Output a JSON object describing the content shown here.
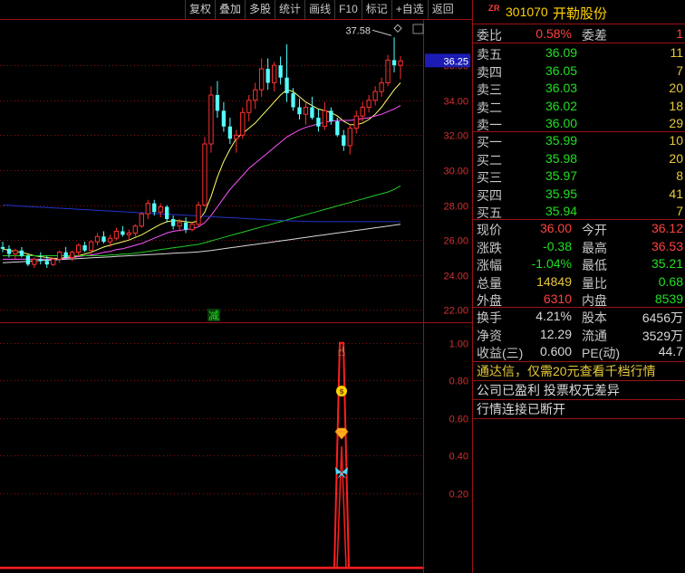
{
  "toolbar": [
    "复权",
    "叠加",
    "多股",
    "统计",
    "画线",
    "F10",
    "标记",
    "+自选",
    "返回"
  ],
  "stock": {
    "badge": "ZR",
    "code": "301070",
    "name": "开勒股份"
  },
  "weibi": {
    "label": "委比",
    "value": "0.58%",
    "label2": "委差",
    "value2": "1"
  },
  "sell": [
    {
      "label": "卖五",
      "price": "36.09",
      "vol": "11"
    },
    {
      "label": "卖四",
      "price": "36.05",
      "vol": "7"
    },
    {
      "label": "卖三",
      "price": "36.03",
      "vol": "20"
    },
    {
      "label": "卖二",
      "price": "36.02",
      "vol": "18"
    },
    {
      "label": "卖一",
      "price": "36.00",
      "vol": "29"
    }
  ],
  "buy": [
    {
      "label": "买一",
      "price": "35.99",
      "vol": "10"
    },
    {
      "label": "买二",
      "price": "35.98",
      "vol": "20"
    },
    {
      "label": "买三",
      "price": "35.97",
      "vol": "8"
    },
    {
      "label": "买四",
      "price": "35.95",
      "vol": "41"
    },
    {
      "label": "买五",
      "price": "35.94",
      "vol": "7"
    }
  ],
  "quote": [
    {
      "l1": "现价",
      "v1": "36.00",
      "c1": "red",
      "l2": "今开",
      "v2": "36.12",
      "c2": "red"
    },
    {
      "l1": "涨跌",
      "v1": "-0.38",
      "c1": "green",
      "l2": "最高",
      "v2": "36.53",
      "c2": "red"
    },
    {
      "l1": "涨幅",
      "v1": "-1.04%",
      "c1": "green",
      "l2": "最低",
      "v2": "35.21",
      "c2": "green"
    },
    {
      "l1": "总量",
      "v1": "14849",
      "c1": "yellow",
      "l2": "量比",
      "v2": "0.68",
      "c2": "green"
    },
    {
      "l1": "外盘",
      "v1": "6310",
      "c1": "red",
      "l2": "内盘",
      "v2": "8539",
      "c2": "green"
    }
  ],
  "fund": [
    {
      "l1": "换手",
      "v1": "4.21%",
      "l2": "股本",
      "v2": "6456万"
    },
    {
      "l1": "净资",
      "v1": "12.29",
      "l2": "流通",
      "v2": "3529万"
    },
    {
      "l1": "收益(三)",
      "v1": "0.600",
      "l2": "PE(动)",
      "v2": "44.7"
    }
  ],
  "notices": [
    {
      "text": "通达信，仅需20元查看千档行情",
      "color": "yellow"
    },
    {
      "text": "公司已盈利 投票权无差异",
      "color": "white"
    },
    {
      "text": "行情连接已断开",
      "color": "white"
    }
  ],
  "chart_data": [
    {
      "type": "candlestick",
      "y_ticks": [
        "36.00",
        "34.00",
        "32.00",
        "30.00",
        "28.00",
        "26.00",
        "24.00",
        "22.00"
      ],
      "ylim": [
        21.5,
        38.6
      ],
      "high_label": "37.58",
      "current_price_label": "36.25",
      "marker_text": "减",
      "ohlc": [
        [
          25.6,
          25.9,
          25.3,
          25.5
        ],
        [
          25.5,
          25.7,
          25.0,
          25.2
        ],
        [
          25.2,
          25.5,
          24.9,
          25.4
        ],
        [
          25.4,
          25.6,
          25.0,
          25.1
        ],
        [
          25.1,
          25.2,
          24.5,
          24.6
        ],
        [
          24.6,
          25.0,
          24.4,
          24.9
        ],
        [
          24.9,
          25.3,
          24.6,
          24.8
        ],
        [
          24.8,
          25.1,
          24.4,
          24.6
        ],
        [
          24.6,
          25.0,
          24.5,
          24.9
        ],
        [
          24.9,
          25.4,
          24.7,
          25.3
        ],
        [
          25.3,
          25.6,
          24.9,
          25.0
        ],
        [
          25.0,
          25.4,
          24.8,
          25.3
        ],
        [
          25.3,
          25.8,
          25.1,
          25.7
        ],
        [
          25.7,
          25.9,
          25.3,
          25.4
        ],
        [
          25.4,
          26.0,
          25.2,
          25.9
        ],
        [
          25.9,
          26.4,
          25.7,
          26.2
        ],
        [
          26.2,
          26.5,
          25.8,
          25.9
        ],
        [
          25.9,
          26.3,
          25.6,
          26.1
        ],
        [
          26.1,
          26.7,
          26.0,
          26.5
        ],
        [
          26.5,
          26.8,
          26.2,
          26.3
        ],
        [
          26.3,
          26.6,
          26.0,
          26.4
        ],
        [
          26.4,
          26.9,
          26.2,
          26.8
        ],
        [
          26.8,
          27.6,
          26.7,
          27.5
        ],
        [
          27.5,
          28.3,
          27.2,
          28.1
        ],
        [
          28.1,
          28.3,
          27.4,
          27.6
        ],
        [
          27.6,
          28.1,
          27.3,
          27.9
        ],
        [
          27.9,
          28.0,
          27.0,
          27.2
        ],
        [
          27.2,
          27.4,
          26.6,
          26.8
        ],
        [
          26.8,
          27.2,
          26.5,
          27.0
        ],
        [
          27.0,
          27.3,
          26.4,
          26.6
        ],
        [
          26.6,
          27.0,
          26.5,
          26.9
        ],
        [
          26.9,
          28.2,
          26.8,
          28.0
        ],
        [
          28.0,
          31.9,
          27.9,
          31.5
        ],
        [
          31.5,
          34.8,
          31.0,
          34.3
        ],
        [
          34.3,
          35.1,
          33.0,
          33.4
        ],
        [
          33.4,
          33.9,
          32.2,
          32.5
        ],
        [
          32.5,
          33.0,
          31.5,
          31.8
        ],
        [
          31.8,
          32.3,
          31.0,
          32.0
        ],
        [
          32.0,
          33.6,
          31.8,
          33.3
        ],
        [
          33.3,
          34.3,
          32.8,
          34.0
        ],
        [
          34.0,
          35.0,
          33.5,
          34.6
        ],
        [
          34.6,
          36.4,
          34.2,
          35.8
        ],
        [
          35.8,
          36.4,
          34.6,
          35.0
        ],
        [
          35.0,
          36.2,
          34.5,
          36.0
        ],
        [
          36.0,
          36.5,
          34.9,
          35.3
        ],
        [
          35.3,
          37.2,
          33.9,
          34.4
        ],
        [
          34.4,
          34.7,
          33.4,
          33.6
        ],
        [
          33.6,
          34.1,
          32.9,
          33.2
        ],
        [
          33.2,
          33.9,
          32.6,
          33.6
        ],
        [
          33.6,
          34.2,
          32.9,
          33.0
        ],
        [
          33.0,
          33.5,
          32.2,
          32.5
        ],
        [
          32.5,
          33.9,
          32.3,
          33.4
        ],
        [
          33.4,
          33.6,
          32.6,
          32.8
        ],
        [
          32.8,
          33.0,
          31.9,
          32.0
        ],
        [
          32.0,
          32.3,
          31.1,
          31.4
        ],
        [
          31.4,
          32.6,
          30.9,
          32.4
        ],
        [
          32.4,
          33.4,
          32.1,
          33.1
        ],
        [
          33.1,
          33.9,
          32.8,
          33.6
        ],
        [
          33.6,
          34.3,
          33.3,
          34.0
        ],
        [
          34.0,
          34.8,
          33.7,
          34.5
        ],
        [
          34.5,
          35.3,
          34.2,
          35.0
        ],
        [
          35.0,
          36.6,
          34.8,
          36.3
        ],
        [
          36.3,
          37.6,
          35.6,
          36.0
        ],
        [
          36.0,
          36.53,
          35.21,
          36.25
        ]
      ],
      "ma_series": [
        {
          "color": "#ffff66",
          "values": [
            25.5,
            25.4,
            25.35,
            25.3,
            25.2,
            25.1,
            25.05,
            25.0,
            24.95,
            24.95,
            25.0,
            25.05,
            25.1,
            25.2,
            25.3,
            25.45,
            25.6,
            25.7,
            25.8,
            25.9,
            26.0,
            26.15,
            26.3,
            26.5,
            26.7,
            26.9,
            27.05,
            27.1,
            27.1,
            27.05,
            27.0,
            27.1,
            27.6,
            28.5,
            29.6,
            30.5,
            31.2,
            31.8,
            32.1,
            32.4,
            32.7,
            33.1,
            33.5,
            33.9,
            34.3,
            34.6,
            34.5,
            34.2,
            33.9,
            33.7,
            33.5,
            33.4,
            33.3,
            33.1,
            32.8,
            32.6,
            32.6,
            32.7,
            32.9,
            33.2,
            33.6,
            34.1,
            34.6,
            35.0
          ]
        },
        {
          "color": "#ff55ff",
          "values": [
            24.9,
            24.9,
            24.9,
            24.9,
            24.9,
            24.9,
            24.9,
            24.9,
            24.9,
            24.9,
            24.95,
            25.0,
            25.05,
            25.1,
            25.15,
            25.2,
            25.3,
            25.35,
            25.45,
            25.5,
            25.6,
            25.7,
            25.8,
            25.95,
            26.1,
            26.25,
            26.4,
            26.5,
            26.55,
            26.6,
            26.65,
            26.75,
            27.0,
            27.4,
            27.9,
            28.4,
            28.9,
            29.3,
            29.7,
            30.1,
            30.4,
            30.7,
            31.0,
            31.3,
            31.6,
            31.9,
            32.1,
            32.3,
            32.45,
            32.55,
            32.65,
            32.75,
            32.8,
            32.85,
            32.85,
            32.85,
            32.9,
            32.95,
            33.0,
            33.1,
            33.2,
            33.35,
            33.5,
            33.7
          ]
        },
        {
          "color": "#22cc22",
          "values": [
            25.1,
            25.1,
            25.1,
            25.1,
            25.1,
            25.1,
            25.1,
            25.1,
            25.1,
            25.1,
            25.1,
            25.1,
            25.1,
            25.1,
            25.1,
            25.1,
            25.1,
            25.15,
            25.15,
            25.2,
            25.2,
            25.25,
            25.3,
            25.35,
            25.4,
            25.45,
            25.5,
            25.55,
            25.6,
            25.65,
            25.7,
            25.75,
            25.85,
            25.95,
            26.05,
            26.15,
            26.25,
            26.35,
            26.45,
            26.55,
            26.65,
            26.75,
            26.85,
            26.95,
            27.05,
            27.15,
            27.25,
            27.35,
            27.45,
            27.55,
            27.65,
            27.75,
            27.85,
            27.95,
            28.05,
            28.15,
            28.25,
            28.35,
            28.45,
            28.55,
            28.65,
            28.75,
            28.9,
            29.1
          ]
        },
        {
          "color": "#d8d8d8",
          "values": [
            24.7,
            24.72,
            24.74,
            24.76,
            24.78,
            24.8,
            24.82,
            24.84,
            24.86,
            24.88,
            24.9,
            24.92,
            24.94,
            24.96,
            24.98,
            25.0,
            25.02,
            25.04,
            25.06,
            25.08,
            25.1,
            25.12,
            25.14,
            25.16,
            25.18,
            25.2,
            25.22,
            25.24,
            25.26,
            25.28,
            25.3,
            25.32,
            25.36,
            25.4,
            25.45,
            25.5,
            25.55,
            25.6,
            25.65,
            25.7,
            25.75,
            25.8,
            25.85,
            25.9,
            25.95,
            26.0,
            26.05,
            26.1,
            26.15,
            26.2,
            26.25,
            26.3,
            26.35,
            26.4,
            26.45,
            26.5,
            26.55,
            26.6,
            26.65,
            26.7,
            26.75,
            26.8,
            26.85,
            26.9
          ]
        },
        {
          "color": "#2233cc",
          "values": [
            28.0,
            27.98,
            27.96,
            27.94,
            27.92,
            27.9,
            27.88,
            27.86,
            27.84,
            27.82,
            27.8,
            27.78,
            27.76,
            27.74,
            27.72,
            27.7,
            27.68,
            27.66,
            27.64,
            27.62,
            27.6,
            27.58,
            27.56,
            27.54,
            27.52,
            27.5,
            27.48,
            27.46,
            27.44,
            27.42,
            27.4,
            27.38,
            27.36,
            27.34,
            27.32,
            27.3,
            27.28,
            27.26,
            27.24,
            27.22,
            27.2,
            27.18,
            27.16,
            27.14,
            27.12,
            27.1,
            27.09,
            27.08,
            27.07,
            27.06,
            27.05,
            27.05,
            27.05,
            27.05,
            27.05,
            27.05,
            27.05,
            27.05,
            27.05,
            27.05,
            27.05,
            27.05,
            27.05,
            27.05
          ]
        }
      ]
    },
    {
      "type": "line",
      "y_ticks": [
        "1.00",
        "0.80",
        "0.60",
        "0.40",
        "0.20"
      ],
      "ylim": [
        -0.2,
        1.1
      ],
      "series": [
        {
          "color": "#ff1e1e",
          "values": [
            -0.2,
            1.0,
            -0.2
          ]
        }
      ],
      "icons": [
        "hand-pointer-icon",
        "money-bag-icon",
        "diamond-icon",
        "butterfly-icon"
      ]
    }
  ]
}
